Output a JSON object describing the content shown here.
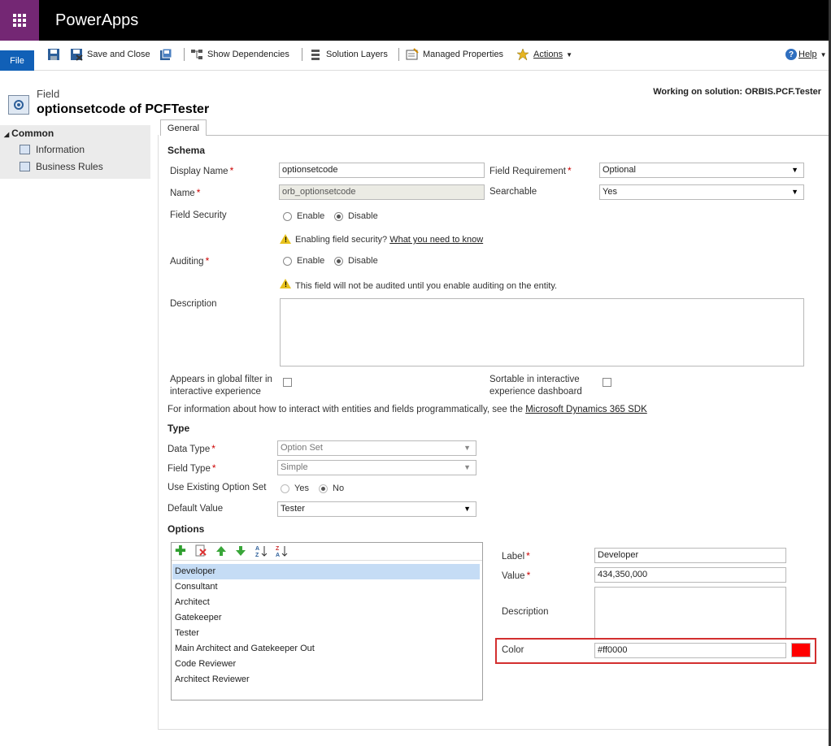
{
  "app": {
    "title": "PowerApps"
  },
  "ribbon": {
    "file": "File",
    "save_close": "Save and Close",
    "show_dependencies": "Show Dependencies",
    "solution_layers": "Solution Layers",
    "managed_properties": "Managed Properties",
    "actions": "Actions",
    "help": "Help"
  },
  "header": {
    "entity_label": "Field",
    "title": "optionsetcode of PCFTester",
    "solution": "Working on solution: ORBIS.PCF.Tester"
  },
  "sidebar": {
    "group": "Common",
    "items": [
      {
        "label": "Information"
      },
      {
        "label": "Business Rules"
      }
    ]
  },
  "tabs": [
    {
      "label": "General"
    }
  ],
  "schema": {
    "section": "Schema",
    "display_name_label": "Display Name",
    "display_name_value": "optionsetcode",
    "name_label": "Name",
    "name_value": "orb_optionsetcode",
    "field_requirement_label": "Field Requirement",
    "field_requirement_value": "Optional",
    "searchable_label": "Searchable",
    "searchable_value": "Yes",
    "field_security_label": "Field Security",
    "enable": "Enable",
    "disable": "Disable",
    "security_warning": "Enabling field security?",
    "security_link": "What you need to know",
    "auditing_label": "Auditing",
    "auditing_warning": "This field will not be audited until you enable auditing on the entity.",
    "description_label": "Description",
    "global_filter_label_1": "Appears in global filter in",
    "global_filter_label_2": "interactive experience",
    "sortable_label_1": "Sortable in interactive",
    "sortable_label_2": "experience dashboard",
    "sdk_text": "For information about how to interact with entities and fields programmatically, see the",
    "sdk_link": "Microsoft Dynamics 365 SDK"
  },
  "type": {
    "section": "Type",
    "data_type_label": "Data Type",
    "data_type_value": "Option Set",
    "field_type_label": "Field Type",
    "field_type_value": "Simple",
    "use_existing_label": "Use Existing Option Set",
    "yes": "Yes",
    "no": "No",
    "default_value_label": "Default Value",
    "default_value": "Tester"
  },
  "options": {
    "section": "Options",
    "items": [
      "Developer",
      "Consultant",
      "Architect",
      "Gatekeeper",
      "Tester",
      "Main Architect and Gatekeeper Out",
      "Code Reviewer",
      "Architect Reviewer"
    ],
    "selected_index": 0,
    "label_label": "Label",
    "label_value": "Developer",
    "value_label": "Value",
    "value_value": "434,350,000",
    "description_label": "Description",
    "color_label": "Color",
    "color_value": "#ff0000",
    "color_swatch": "#ff0000"
  },
  "colors": {
    "brand": "#742774",
    "file_button": "#1160b7",
    "highlight": "#d32f2f"
  }
}
